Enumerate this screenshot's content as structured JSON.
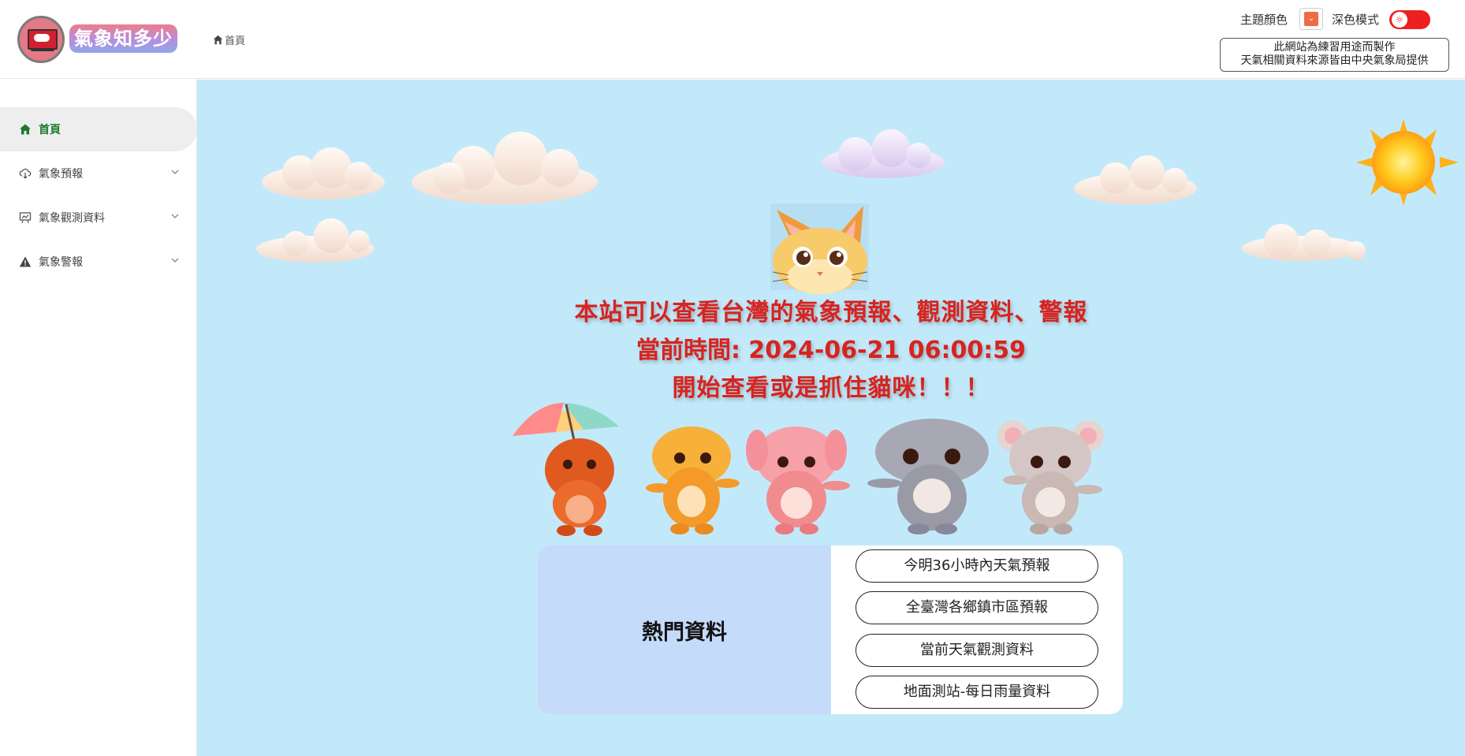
{
  "header": {
    "site_name": "氣象知多少",
    "breadcrumb": "首頁",
    "theme_color_label": "主題顏色",
    "theme_color_value": "#ee6b45",
    "dark_mode_label": "深色模式",
    "dark_mode_on": false,
    "notice_line1": "此網站為練習用途而製作",
    "notice_line2": "天氣相關資料來源皆由中央氣象局提供"
  },
  "sidebar": {
    "items": [
      {
        "label": "首頁",
        "icon": "home-icon",
        "active": true
      },
      {
        "label": "氣象預報",
        "icon": "cloud-download-icon",
        "expandable": true
      },
      {
        "label": "氣象觀測資料",
        "icon": "chart-board-icon",
        "expandable": true
      },
      {
        "label": "氣象警報",
        "icon": "warning-icon",
        "expandable": true
      }
    ]
  },
  "main": {
    "headline1": "本站可以查看台灣的氣象預報、觀測資料、警報",
    "headline2": "當前時間: 2024-06-21 06:00:59",
    "headline3": "開始查看或是抓住貓咪！！！",
    "hot": {
      "title": "熱門資料",
      "links": [
        "今明36小時內天氣預報",
        "全臺灣各鄉鎮市區預報",
        "當前天氣觀測資料",
        "地面測站-每日雨量資料"
      ]
    }
  },
  "colors": {
    "accent": "#1a7a2e",
    "headline": "#d8231f",
    "background": "#c2e9fa",
    "toggle": "#ee1f1f"
  }
}
